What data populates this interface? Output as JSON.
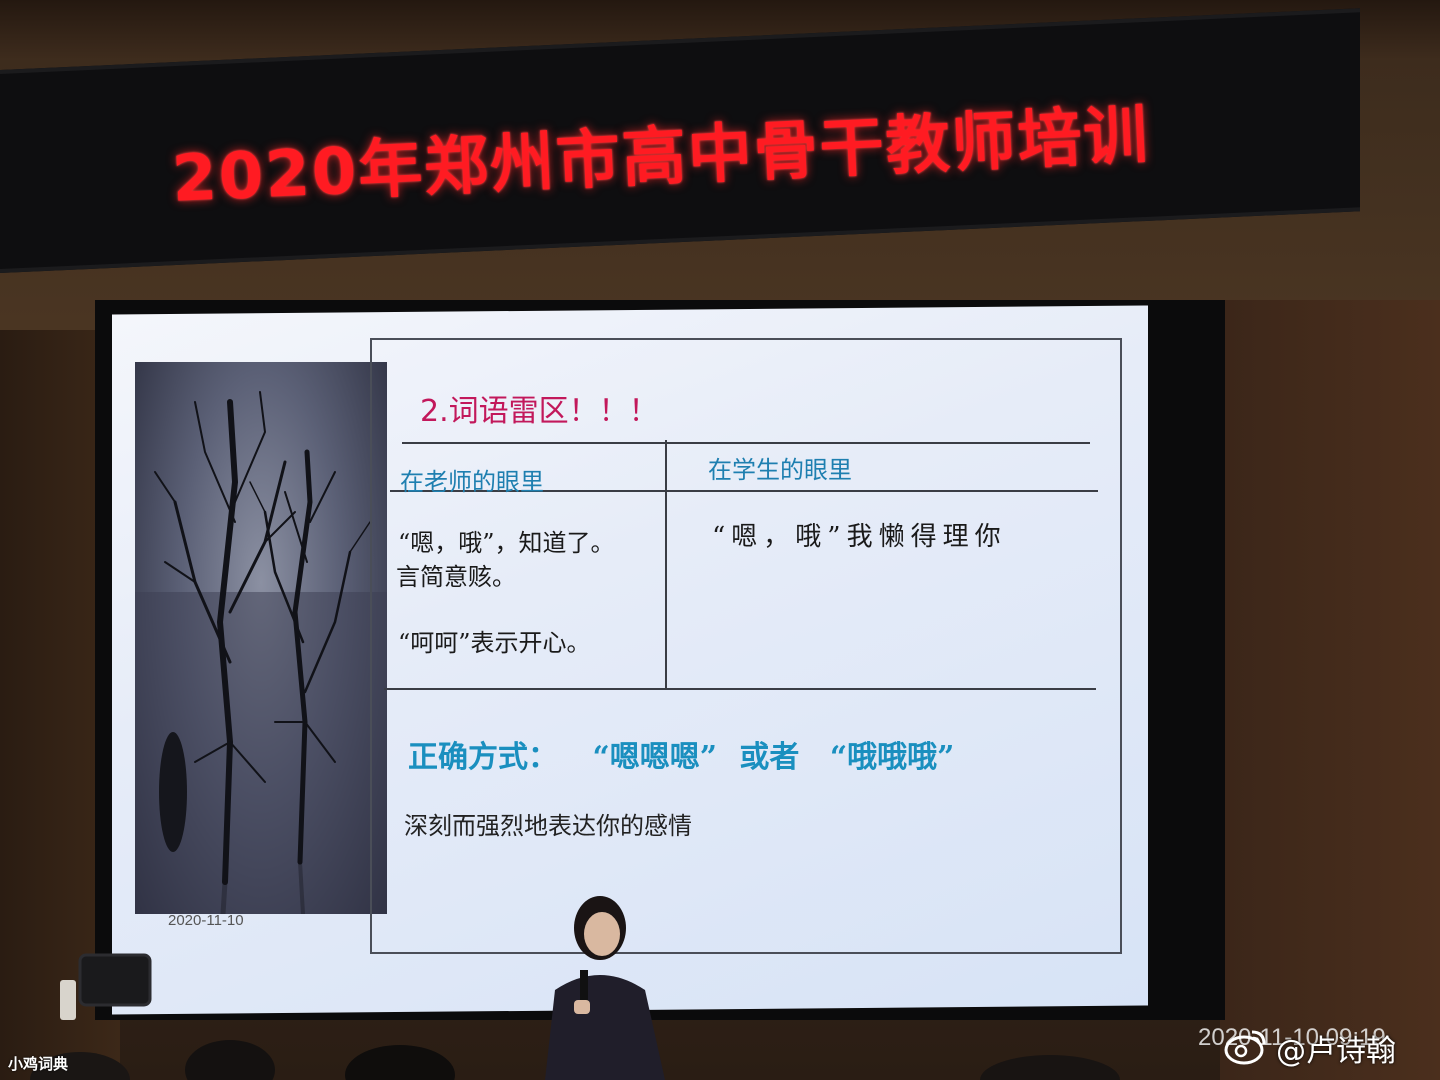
{
  "banner": {
    "text": "2020年郑州市高中骨干教师培训"
  },
  "slide": {
    "title": "2.词语雷区！！！",
    "left_header": "在老师的眼里",
    "right_header": "在学生的眼里",
    "left_line1": "“嗯，哦”，知道了。",
    "left_line2": "言简意赅。",
    "left_line3": "“呵呵”表示开心。",
    "right_line1": "“嗯，哦”我懒得理你",
    "correct_label": "正确方式：",
    "correct_option1": "“嗯嗯嗯”",
    "correct_or": "或者",
    "correct_option2": "“哦哦哦”",
    "deep_text": "深刻而强烈地表达你的感情",
    "date": "2020-11-10"
  },
  "watermark": {
    "left": "小鸡词典",
    "timestamp": "2020-11-10 09:19",
    "handle": "@卢诗翰"
  },
  "colors": {
    "banner_text": "#ff1b22",
    "slide_title": "#c2185b",
    "column_header": "#1e7fb0",
    "correct_text": "#1a8fbf"
  }
}
